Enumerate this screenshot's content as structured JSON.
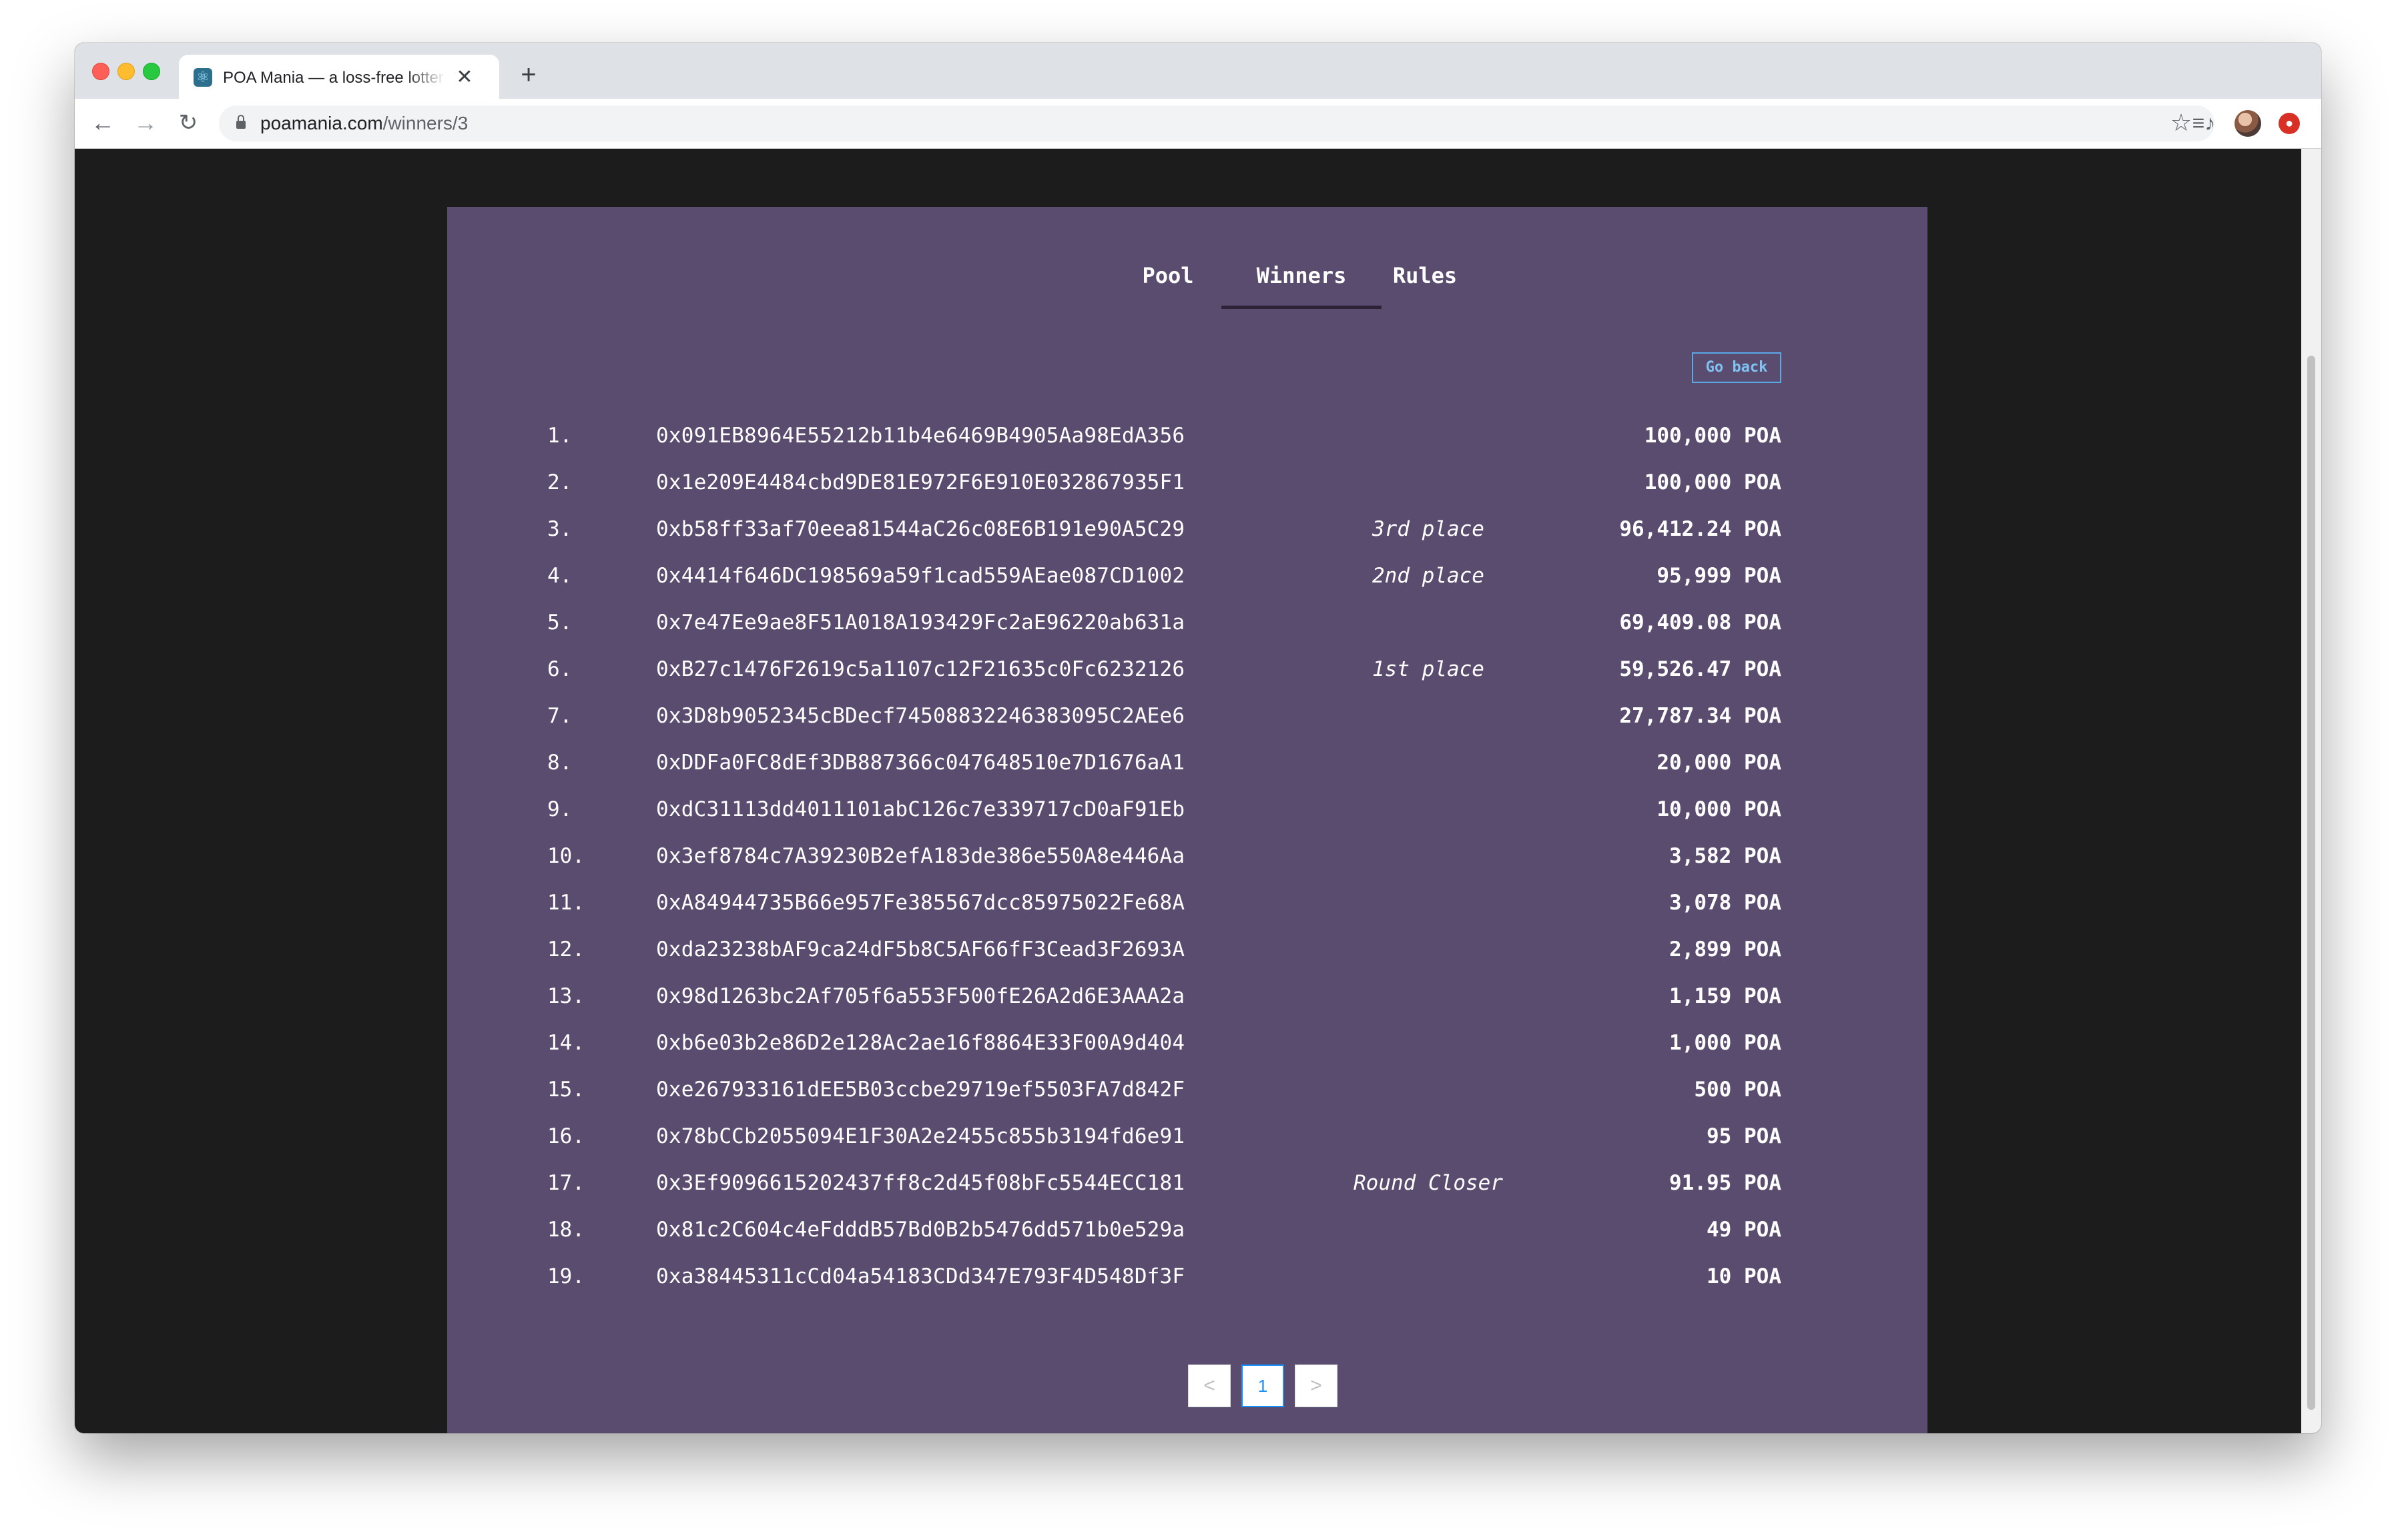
{
  "browser": {
    "tab_title": "POA Mania — a loss-free lottery",
    "tab_close": "✕",
    "new_tab": "+",
    "url_host": "poamania.com",
    "url_path": "/winners/3",
    "back": "←",
    "forward": "→",
    "reload": "↻",
    "star": "☆",
    "media": "≡♪",
    "extension": "●"
  },
  "nav": {
    "tabs": [
      {
        "label": "Pool",
        "active": false
      },
      {
        "label": "Winners",
        "active": true
      },
      {
        "label": "Rules",
        "active": false
      }
    ]
  },
  "go_back_label": "Go back",
  "winners": [
    {
      "rank": "1.",
      "address": "0x091EB8964E55212b11b4e6469B4905Aa98EdA356",
      "place": "",
      "amount": "100,000 POA"
    },
    {
      "rank": "2.",
      "address": "0x1e209E4484cbd9DE81E972F6E910E032867935F1",
      "place": "",
      "amount": "100,000 POA"
    },
    {
      "rank": "3.",
      "address": "0xb58ff33af70eea81544aC26c08E6B191e90A5C29",
      "place": "3rd place",
      "amount": "96,412.24 POA"
    },
    {
      "rank": "4.",
      "address": "0x4414f646DC198569a59f1cad559AEae087CD1002",
      "place": "2nd place",
      "amount": "95,999 POA"
    },
    {
      "rank": "5.",
      "address": "0x7e47Ee9ae8F51A018A193429Fc2aE96220ab631a",
      "place": "",
      "amount": "69,409.08 POA"
    },
    {
      "rank": "6.",
      "address": "0xB27c1476F2619c5a1107c12F21635c0Fc6232126",
      "place": "1st place",
      "amount": "59,526.47 POA"
    },
    {
      "rank": "7.",
      "address": "0x3D8b9052345cBDecf74508832246383095C2AEe6",
      "place": "",
      "amount": "27,787.34 POA"
    },
    {
      "rank": "8.",
      "address": "0xDDFa0FC8dEf3DB887366c047648510e7D1676aA1",
      "place": "",
      "amount": "20,000 POA"
    },
    {
      "rank": "9.",
      "address": "0xdC31113dd4011101abC126c7e339717cD0aF91Eb",
      "place": "",
      "amount": "10,000 POA"
    },
    {
      "rank": "10.",
      "address": "0x3ef8784c7A39230B2efA183de386e550A8e446Aa",
      "place": "",
      "amount": "3,582 POA"
    },
    {
      "rank": "11.",
      "address": "0xA84944735B66e957Fe385567dcc85975022Fe68A",
      "place": "",
      "amount": "3,078 POA"
    },
    {
      "rank": "12.",
      "address": "0xda23238bAF9ca24dF5b8C5AF66fF3Cead3F2693A",
      "place": "",
      "amount": "2,899 POA"
    },
    {
      "rank": "13.",
      "address": "0x98d1263bc2Af705f6a553F500fE26A2d6E3AAA2a",
      "place": "",
      "amount": "1,159 POA"
    },
    {
      "rank": "14.",
      "address": "0xb6e03b2e86D2e128Ac2ae16f8864E33F00A9d404",
      "place": "",
      "amount": "1,000 POA"
    },
    {
      "rank": "15.",
      "address": "0xe267933161dEE5B03ccbe29719ef5503FA7d842F",
      "place": "",
      "amount": "500 POA"
    },
    {
      "rank": "16.",
      "address": "0x78bCCb2055094E1F30A2e2455c855b3194fd6e91",
      "place": "",
      "amount": "95 POA"
    },
    {
      "rank": "17.",
      "address": "0x3Ef9096615202437ff8c2d45f08bFc5544ECC181",
      "place": "Round Closer",
      "amount": "91.95 POA"
    },
    {
      "rank": "18.",
      "address": "0x81c2C604c4eFdddB57Bd0B2b5476dd571b0e529a",
      "place": "",
      "amount": "49 POA"
    },
    {
      "rank": "19.",
      "address": "0xa38445311cCd04a54183CDd347E793F4D548Df3F",
      "place": "",
      "amount": "10 POA"
    }
  ],
  "pagination": {
    "prev": "<",
    "current": "1",
    "next": ">"
  },
  "colors": {
    "panel": "#5a4c6f",
    "page_background": "#1c1c1c",
    "link": "#7fc3f5",
    "active_page": "#1890ff"
  }
}
